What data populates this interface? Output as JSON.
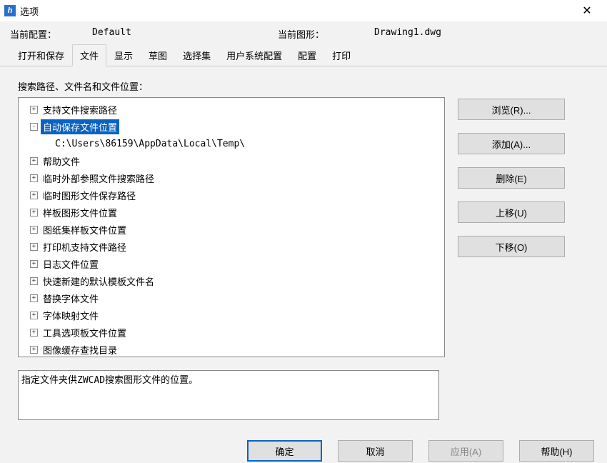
{
  "window": {
    "title": "选项",
    "icon_letter": "h",
    "close_glyph": "✕"
  },
  "header": {
    "profile_label": "当前配置：",
    "profile_value": "Default",
    "drawing_label": "当前图形：",
    "drawing_value": "Drawing1.dwg"
  },
  "tabs": [
    {
      "label": "打开和保存"
    },
    {
      "label": "文件",
      "active": true
    },
    {
      "label": "显示"
    },
    {
      "label": "草图"
    },
    {
      "label": "选择集"
    },
    {
      "label": "用户系统配置"
    },
    {
      "label": "配置"
    },
    {
      "label": "打印"
    }
  ],
  "section_label": "搜索路径、文件名和文件位置：",
  "tree": [
    {
      "level": 0,
      "toggle": "+",
      "label": "支持文件搜索路径"
    },
    {
      "level": 0,
      "toggle": "-",
      "label": "自动保存文件位置",
      "selected": true
    },
    {
      "level": 1,
      "toggle": "",
      "label": "C:\\Users\\86159\\AppData\\Local\\Temp\\"
    },
    {
      "level": 0,
      "toggle": "+",
      "label": "帮助文件"
    },
    {
      "level": 0,
      "toggle": "+",
      "label": "临时外部参照文件搜索路径"
    },
    {
      "level": 0,
      "toggle": "+",
      "label": "临时图形文件保存路径"
    },
    {
      "level": 0,
      "toggle": "+",
      "label": "样板图形文件位置"
    },
    {
      "level": 0,
      "toggle": "+",
      "label": "图纸集样板文件位置"
    },
    {
      "level": 0,
      "toggle": "+",
      "label": "打印机支持文件路径"
    },
    {
      "level": 0,
      "toggle": "+",
      "label": "日志文件位置"
    },
    {
      "level": 0,
      "toggle": "+",
      "label": "快速新建的默认模板文件名"
    },
    {
      "level": 0,
      "toggle": "+",
      "label": "替换字体文件"
    },
    {
      "level": 0,
      "toggle": "+",
      "label": "字体映射文件"
    },
    {
      "level": 0,
      "toggle": "+",
      "label": "工具选项板文件位置"
    },
    {
      "level": 0,
      "toggle": "+",
      "label": "图像缓存查找目录"
    }
  ],
  "side_buttons": {
    "browse": "浏览(R)...",
    "add": "添加(A)...",
    "delete": "删除(E)",
    "move_up": "上移(U)",
    "move_down": "下移(O)"
  },
  "description": "指定文件夹供ZWCAD搜索图形文件的位置。",
  "bottom_buttons": {
    "ok": "确定",
    "cancel": "取消",
    "apply": "应用(A)",
    "help": "帮助(H)"
  }
}
